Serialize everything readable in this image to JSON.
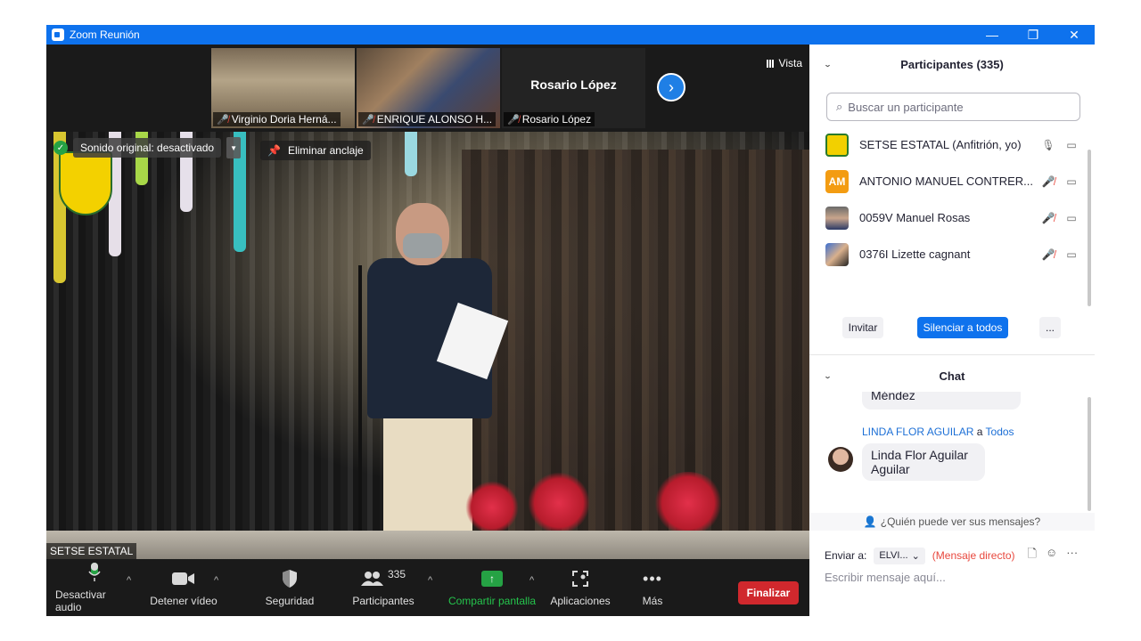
{
  "window": {
    "title": "Zoom Reunión"
  },
  "titlebar": {
    "minimize_icon": "minimize-icon",
    "restore_icon": "restore-icon",
    "close_icon": "close-icon"
  },
  "thumbnails": [
    {
      "label": "Virginio Doria Herná...",
      "muted": true
    },
    {
      "label": "ENRIQUE ALONSO H...",
      "muted": true
    },
    {
      "label": "Rosario López",
      "big_name": "Rosario López",
      "muted": true
    }
  ],
  "view": {
    "vista_label": "Vista"
  },
  "stage": {
    "sonido_label": "Sonido original: desactivado",
    "anclaje_label": "Eliminar anclaje",
    "speaker_name": "SETSE ESTATAL"
  },
  "toolbar": {
    "audio_label": "Desactivar audio",
    "video_label": "Detener vídeo",
    "security_label": "Seguridad",
    "participants_label": "Participantes",
    "participants_count": "335",
    "share_label": "Compartir pantalla",
    "apps_label": "Aplicaciones",
    "more_label": "Más",
    "end_label": "Finalizar"
  },
  "participants_panel": {
    "title": "Participantes (335)",
    "search_placeholder": "Buscar un participante",
    "items": [
      {
        "name": "SETSE ESTATAL (Anfitrión, yo)",
        "avatar": "logo",
        "mic": "on"
      },
      {
        "name": "ANTONIO MANUEL CONTRER...",
        "avatar": "AM",
        "mic": "muted"
      },
      {
        "name": "0059V Manuel Rosas",
        "avatar": "photo",
        "mic": "muted"
      },
      {
        "name": "0376I Lizette cagnant",
        "avatar": "photo",
        "mic": "muted"
      }
    ],
    "invite_label": "Invitar",
    "mute_all_label": "Silenciar a todos",
    "more_label": "..."
  },
  "chat_panel": {
    "title": "Chat",
    "messages": [
      {
        "text": "Méndez"
      },
      {
        "from": "LINDA FLOR AGUILAR",
        "to_word": "a",
        "to": "Todos",
        "text_line1": "Linda Flor Aguilar",
        "text_line2": "Aguilar"
      }
    ],
    "who_can_see": "¿Quién puede ver sus mensajes?",
    "send_to_label": "Enviar a:",
    "send_to_value": "ELVI...",
    "direct_label": "(Mensaje directo)",
    "input_placeholder": "Escribir mensaje aquí..."
  },
  "colors": {
    "accent": "#0e72ed",
    "end": "#d0282d",
    "share": "#25a244",
    "muted": "#e8473d"
  }
}
